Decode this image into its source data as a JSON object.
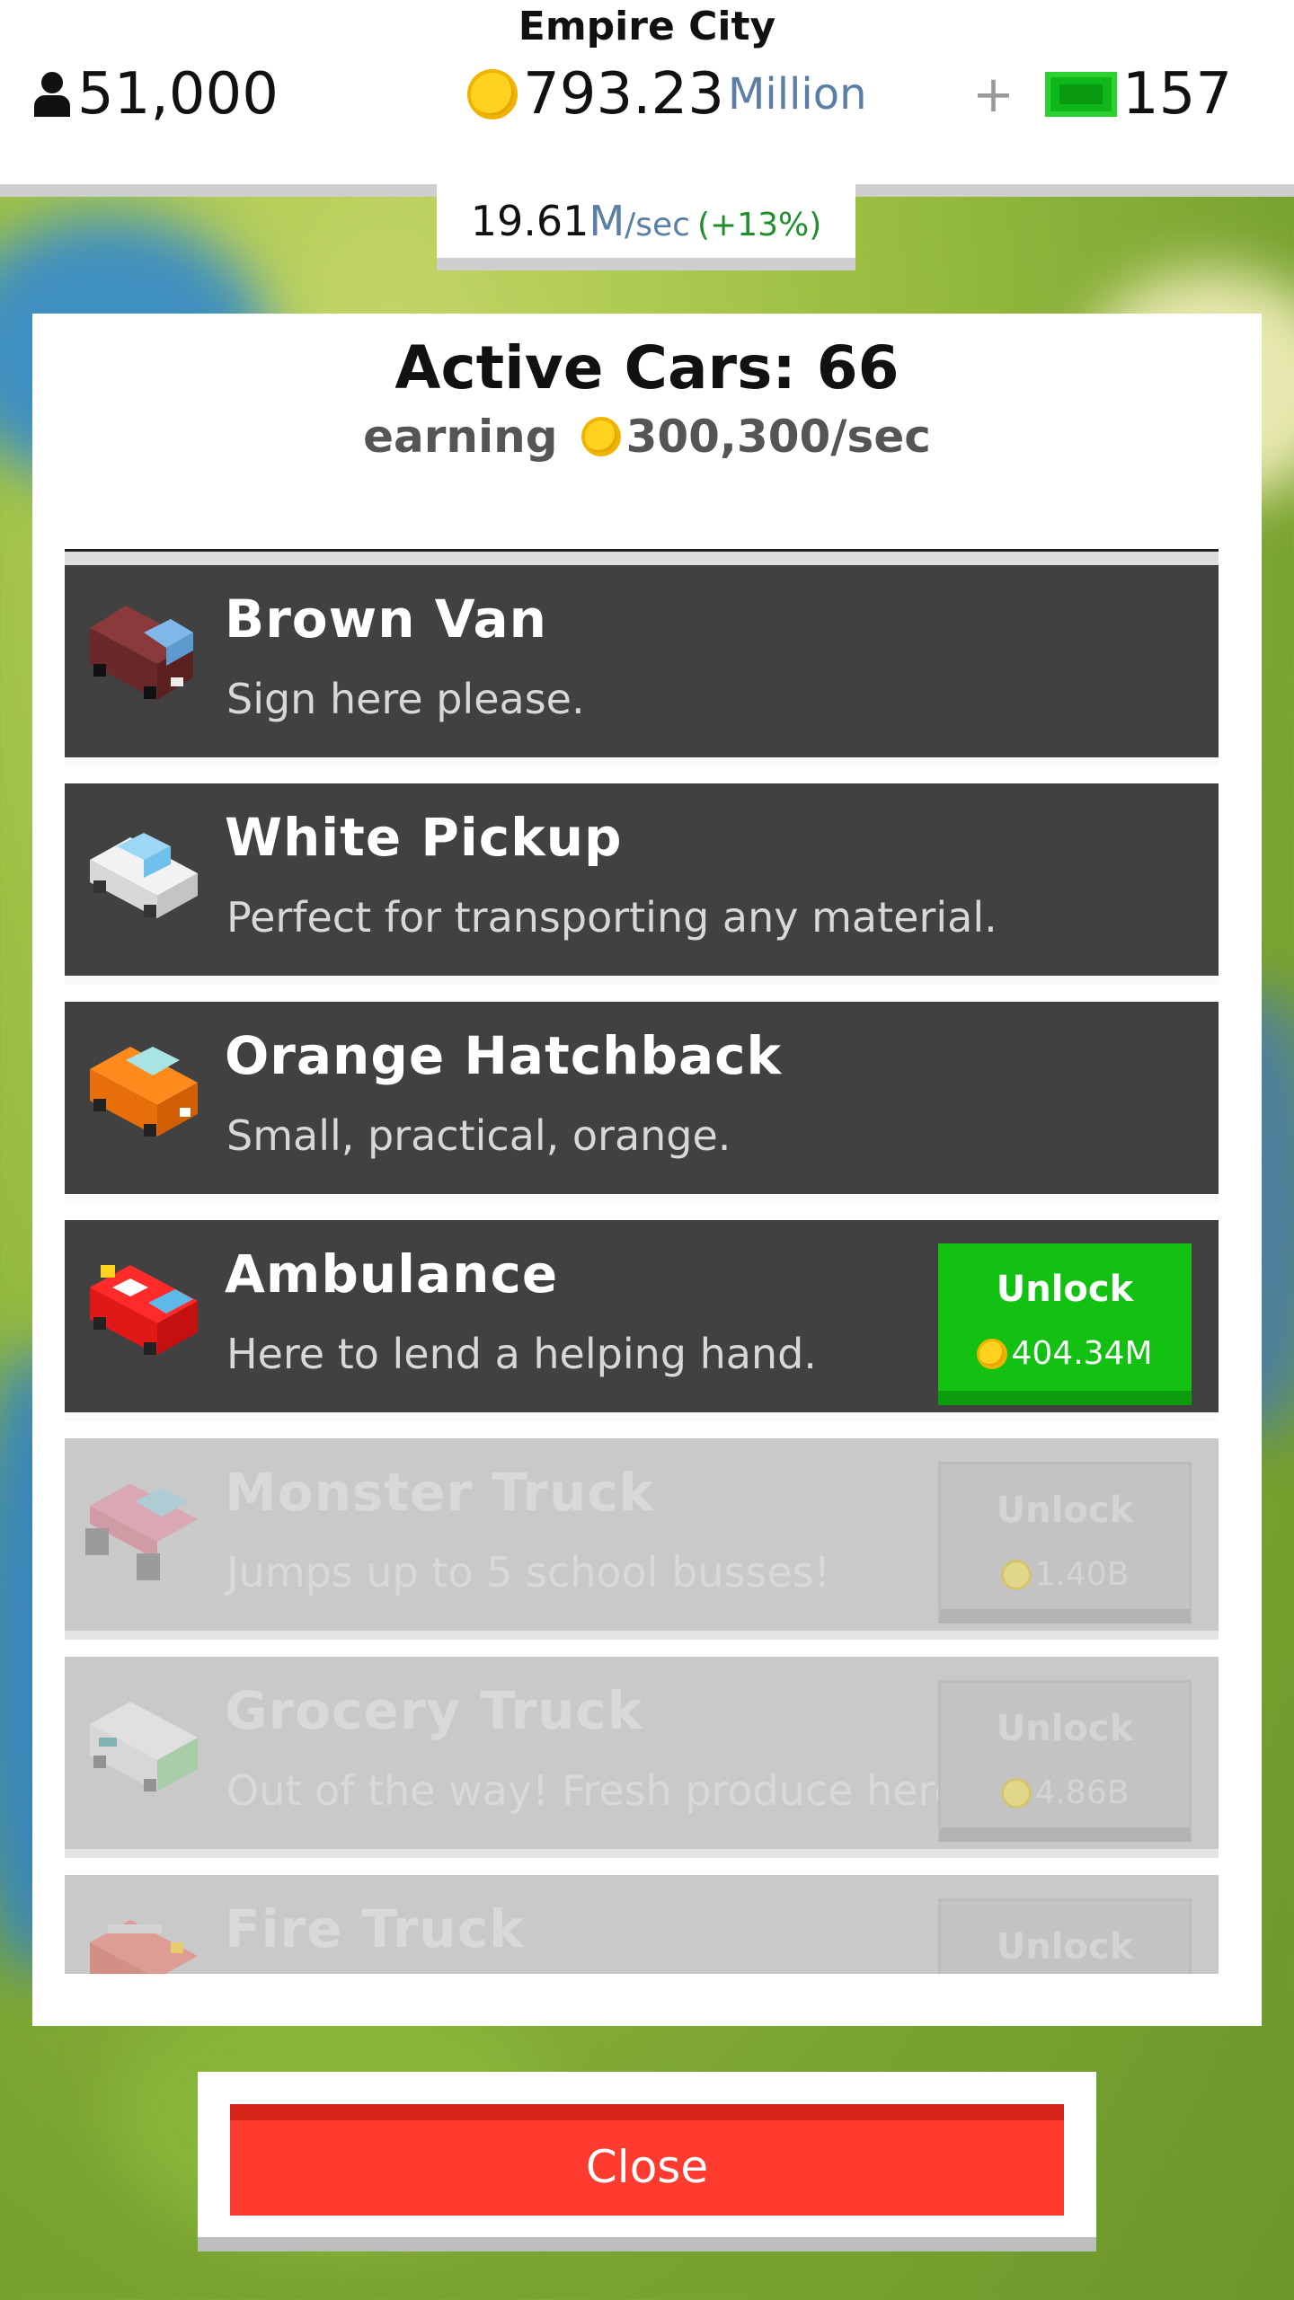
{
  "header": {
    "city_name": "Empire City",
    "population": "51,000",
    "coins_value": "793.23",
    "coins_unit": "Million",
    "plus_label": "+",
    "cash": "157"
  },
  "rate": {
    "value": "19.61",
    "unit": "M",
    "per": "/sec",
    "bonus": "(+13%)"
  },
  "panel": {
    "title": "Active Cars: 66",
    "earning_label": "earning",
    "earning_value": "300,300/sec"
  },
  "cars": [
    {
      "name": "Brown Van",
      "desc": "Sign here please.",
      "state": "owned",
      "icon": "brown-van-icon"
    },
    {
      "name": "White Pickup",
      "desc": "Perfect for transporting any material.",
      "state": "owned",
      "icon": "white-pickup-icon"
    },
    {
      "name": "Orange Hatchback",
      "desc": "Small, practical, orange.",
      "state": "owned",
      "icon": "orange-hatchback-icon"
    },
    {
      "name": "Ambulance",
      "desc": "Here to lend a helping hand.",
      "state": "unlockable",
      "unlock_label": "Unlock",
      "price": "404.34M",
      "icon": "ambulance-icon"
    },
    {
      "name": "Monster Truck",
      "desc": "Jumps up to 5 school busses!",
      "state": "locked",
      "unlock_label": "Unlock",
      "price": "1.40B",
      "icon": "monster-truck-icon"
    },
    {
      "name": "Grocery Truck",
      "desc": "Out of the way! Fresh produce here!",
      "state": "locked",
      "unlock_label": "Unlock",
      "price": "4.86B",
      "icon": "grocery-truck-icon"
    },
    {
      "name": "Fire Truck",
      "desc": "",
      "state": "locked",
      "unlock_label": "Unlock",
      "icon": "fire-truck-icon"
    }
  ],
  "close_button": {
    "label": "Close"
  },
  "colors": {
    "unlock_green": "#12c112",
    "close_red": "#ff3b30",
    "row_dark": "#414141",
    "row_locked": "#c9c9c9",
    "coin_gold": "#ffd21f"
  }
}
